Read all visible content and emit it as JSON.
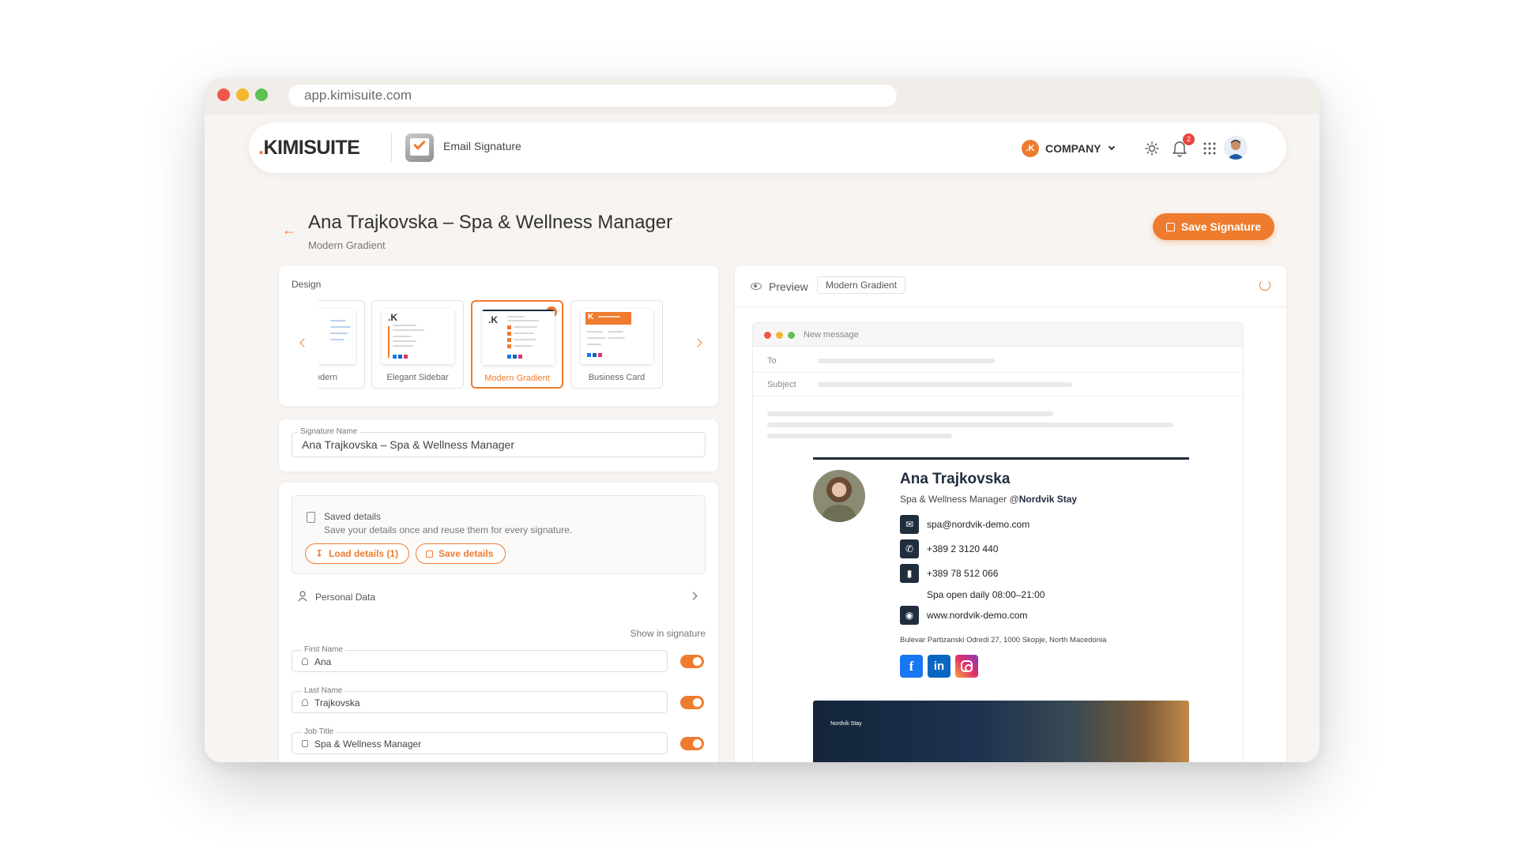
{
  "browser": {
    "url": "app.kimisuite.com"
  },
  "topnav": {
    "logo_dot": ".",
    "logo_text": "KIMISUITE",
    "app_title": "Email Signature",
    "company_initial": ".K",
    "company_label": "COMPANY",
    "notification_count": "2"
  },
  "header": {
    "title": "Ana Trajkovska – Spa & Wellness Manager",
    "subtitle": "Modern Gradient",
    "save_label": "Save Signature"
  },
  "design": {
    "label": "Design",
    "templates": [
      {
        "name": "Modern",
        "visible_name": "lodern",
        "selected": false
      },
      {
        "name": "Elegant Sidebar",
        "selected": false
      },
      {
        "name": "Modern Gradient",
        "selected": true
      },
      {
        "name": "Business Card",
        "selected": false
      }
    ]
  },
  "signature_name": {
    "label": "Signature Name",
    "value": "Ana Trajkovska – Spa & Wellness Manager"
  },
  "saved_details": {
    "title": "Saved details",
    "description": "Save your details once and reuse them for every signature.",
    "load_label": "Load details (1)",
    "save_label": "Save details"
  },
  "personal_data": {
    "label": "Personal Data",
    "show_in_signature": "Show in signature",
    "fields": [
      {
        "label": "First Name",
        "value": "Ana",
        "shown": true
      },
      {
        "label": "Last Name",
        "value": "Trajkovska",
        "shown": true
      },
      {
        "label": "Job Title",
        "value": "Spa & Wellness Manager",
        "shown": true
      }
    ]
  },
  "preview": {
    "label": "Preview",
    "template_tag": "Modern Gradient",
    "compose": {
      "title": "New message",
      "to_label": "To",
      "subject_label": "Subject"
    },
    "signature": {
      "name": "Ana Trajkovska",
      "role": "Spa & Wellness Manager @",
      "company": "Nordvik Stay",
      "email": "spa@nordvik-demo.com",
      "phone": "+389 2 3120 440",
      "mobile": "+389 78 512 066",
      "hours": "Spa open daily 08:00–21:00",
      "website": "www.nordvik-demo.com",
      "address": "Bulevar Partizanski Odredi 27, 1000 Skopje, North Macedonia",
      "social": [
        "facebook",
        "linkedin",
        "instagram"
      ],
      "banner_logo": "Nordvik Stay"
    }
  },
  "colors": {
    "accent": "#ef7b2e",
    "navy": "#1f2d3d",
    "facebook": "#1877f2",
    "linkedin": "#0a66c2"
  }
}
